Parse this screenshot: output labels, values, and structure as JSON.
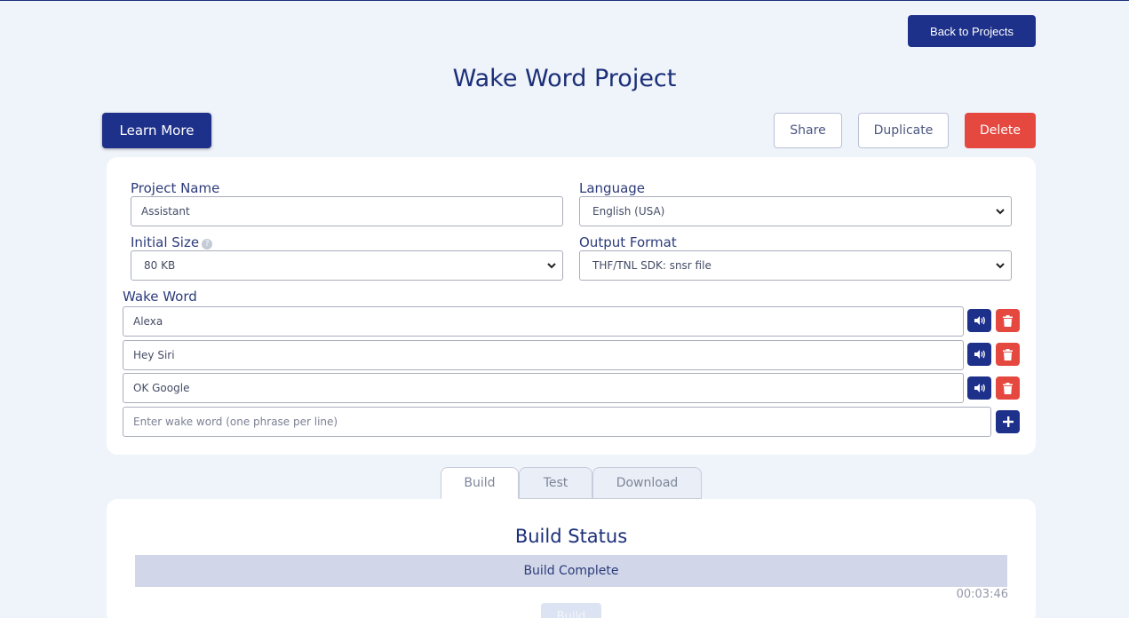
{
  "header": {
    "back_label": "Back to Projects",
    "title": "Wake Word Project"
  },
  "actions": {
    "learn_more": "Learn More",
    "share": "Share",
    "duplicate": "Duplicate",
    "delete": "Delete"
  },
  "form": {
    "project_name_label": "Project Name",
    "project_name_value": "Assistant",
    "language_label": "Language",
    "language_value": "English (USA)",
    "initial_size_label": "Initial Size",
    "initial_size_value": "80 KB",
    "output_format_label": "Output Format",
    "output_format_value": "THF/TNL SDK: snsr file",
    "wake_word_label": "Wake Word",
    "wake_words": [
      "Alexa",
      "Hey Siri",
      "OK Google"
    ],
    "new_wake_word_placeholder": "Enter wake word (one phrase per line)"
  },
  "tabs": [
    "Build",
    "Test",
    "Download"
  ],
  "build": {
    "title": "Build Status",
    "status": "Build Complete",
    "elapsed": "00:03:46",
    "button": "Build"
  },
  "colors": {
    "brand": "#1e318a",
    "danger": "#e5483f",
    "background": "#eff3fa"
  }
}
